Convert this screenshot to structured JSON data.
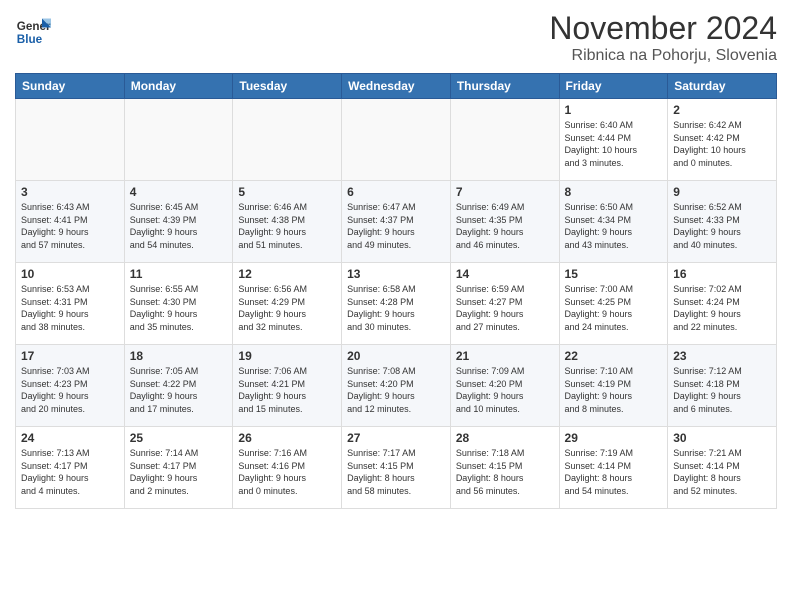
{
  "logo": {
    "line1": "General",
    "line2": "Blue"
  },
  "title": "November 2024",
  "location": "Ribnica na Pohorju, Slovenia",
  "weekdays": [
    "Sunday",
    "Monday",
    "Tuesday",
    "Wednesday",
    "Thursday",
    "Friday",
    "Saturday"
  ],
  "weeks": [
    [
      {
        "day": "",
        "info": ""
      },
      {
        "day": "",
        "info": ""
      },
      {
        "day": "",
        "info": ""
      },
      {
        "day": "",
        "info": ""
      },
      {
        "day": "",
        "info": ""
      },
      {
        "day": "1",
        "info": "Sunrise: 6:40 AM\nSunset: 4:44 PM\nDaylight: 10 hours\nand 3 minutes."
      },
      {
        "day": "2",
        "info": "Sunrise: 6:42 AM\nSunset: 4:42 PM\nDaylight: 10 hours\nand 0 minutes."
      }
    ],
    [
      {
        "day": "3",
        "info": "Sunrise: 6:43 AM\nSunset: 4:41 PM\nDaylight: 9 hours\nand 57 minutes."
      },
      {
        "day": "4",
        "info": "Sunrise: 6:45 AM\nSunset: 4:39 PM\nDaylight: 9 hours\nand 54 minutes."
      },
      {
        "day": "5",
        "info": "Sunrise: 6:46 AM\nSunset: 4:38 PM\nDaylight: 9 hours\nand 51 minutes."
      },
      {
        "day": "6",
        "info": "Sunrise: 6:47 AM\nSunset: 4:37 PM\nDaylight: 9 hours\nand 49 minutes."
      },
      {
        "day": "7",
        "info": "Sunrise: 6:49 AM\nSunset: 4:35 PM\nDaylight: 9 hours\nand 46 minutes."
      },
      {
        "day": "8",
        "info": "Sunrise: 6:50 AM\nSunset: 4:34 PM\nDaylight: 9 hours\nand 43 minutes."
      },
      {
        "day": "9",
        "info": "Sunrise: 6:52 AM\nSunset: 4:33 PM\nDaylight: 9 hours\nand 40 minutes."
      }
    ],
    [
      {
        "day": "10",
        "info": "Sunrise: 6:53 AM\nSunset: 4:31 PM\nDaylight: 9 hours\nand 38 minutes."
      },
      {
        "day": "11",
        "info": "Sunrise: 6:55 AM\nSunset: 4:30 PM\nDaylight: 9 hours\nand 35 minutes."
      },
      {
        "day": "12",
        "info": "Sunrise: 6:56 AM\nSunset: 4:29 PM\nDaylight: 9 hours\nand 32 minutes."
      },
      {
        "day": "13",
        "info": "Sunrise: 6:58 AM\nSunset: 4:28 PM\nDaylight: 9 hours\nand 30 minutes."
      },
      {
        "day": "14",
        "info": "Sunrise: 6:59 AM\nSunset: 4:27 PM\nDaylight: 9 hours\nand 27 minutes."
      },
      {
        "day": "15",
        "info": "Sunrise: 7:00 AM\nSunset: 4:25 PM\nDaylight: 9 hours\nand 24 minutes."
      },
      {
        "day": "16",
        "info": "Sunrise: 7:02 AM\nSunset: 4:24 PM\nDaylight: 9 hours\nand 22 minutes."
      }
    ],
    [
      {
        "day": "17",
        "info": "Sunrise: 7:03 AM\nSunset: 4:23 PM\nDaylight: 9 hours\nand 20 minutes."
      },
      {
        "day": "18",
        "info": "Sunrise: 7:05 AM\nSunset: 4:22 PM\nDaylight: 9 hours\nand 17 minutes."
      },
      {
        "day": "19",
        "info": "Sunrise: 7:06 AM\nSunset: 4:21 PM\nDaylight: 9 hours\nand 15 minutes."
      },
      {
        "day": "20",
        "info": "Sunrise: 7:08 AM\nSunset: 4:20 PM\nDaylight: 9 hours\nand 12 minutes."
      },
      {
        "day": "21",
        "info": "Sunrise: 7:09 AM\nSunset: 4:20 PM\nDaylight: 9 hours\nand 10 minutes."
      },
      {
        "day": "22",
        "info": "Sunrise: 7:10 AM\nSunset: 4:19 PM\nDaylight: 9 hours\nand 8 minutes."
      },
      {
        "day": "23",
        "info": "Sunrise: 7:12 AM\nSunset: 4:18 PM\nDaylight: 9 hours\nand 6 minutes."
      }
    ],
    [
      {
        "day": "24",
        "info": "Sunrise: 7:13 AM\nSunset: 4:17 PM\nDaylight: 9 hours\nand 4 minutes."
      },
      {
        "day": "25",
        "info": "Sunrise: 7:14 AM\nSunset: 4:17 PM\nDaylight: 9 hours\nand 2 minutes."
      },
      {
        "day": "26",
        "info": "Sunrise: 7:16 AM\nSunset: 4:16 PM\nDaylight: 9 hours\nand 0 minutes."
      },
      {
        "day": "27",
        "info": "Sunrise: 7:17 AM\nSunset: 4:15 PM\nDaylight: 8 hours\nand 58 minutes."
      },
      {
        "day": "28",
        "info": "Sunrise: 7:18 AM\nSunset: 4:15 PM\nDaylight: 8 hours\nand 56 minutes."
      },
      {
        "day": "29",
        "info": "Sunrise: 7:19 AM\nSunset: 4:14 PM\nDaylight: 8 hours\nand 54 minutes."
      },
      {
        "day": "30",
        "info": "Sunrise: 7:21 AM\nSunset: 4:14 PM\nDaylight: 8 hours\nand 52 minutes."
      }
    ]
  ]
}
